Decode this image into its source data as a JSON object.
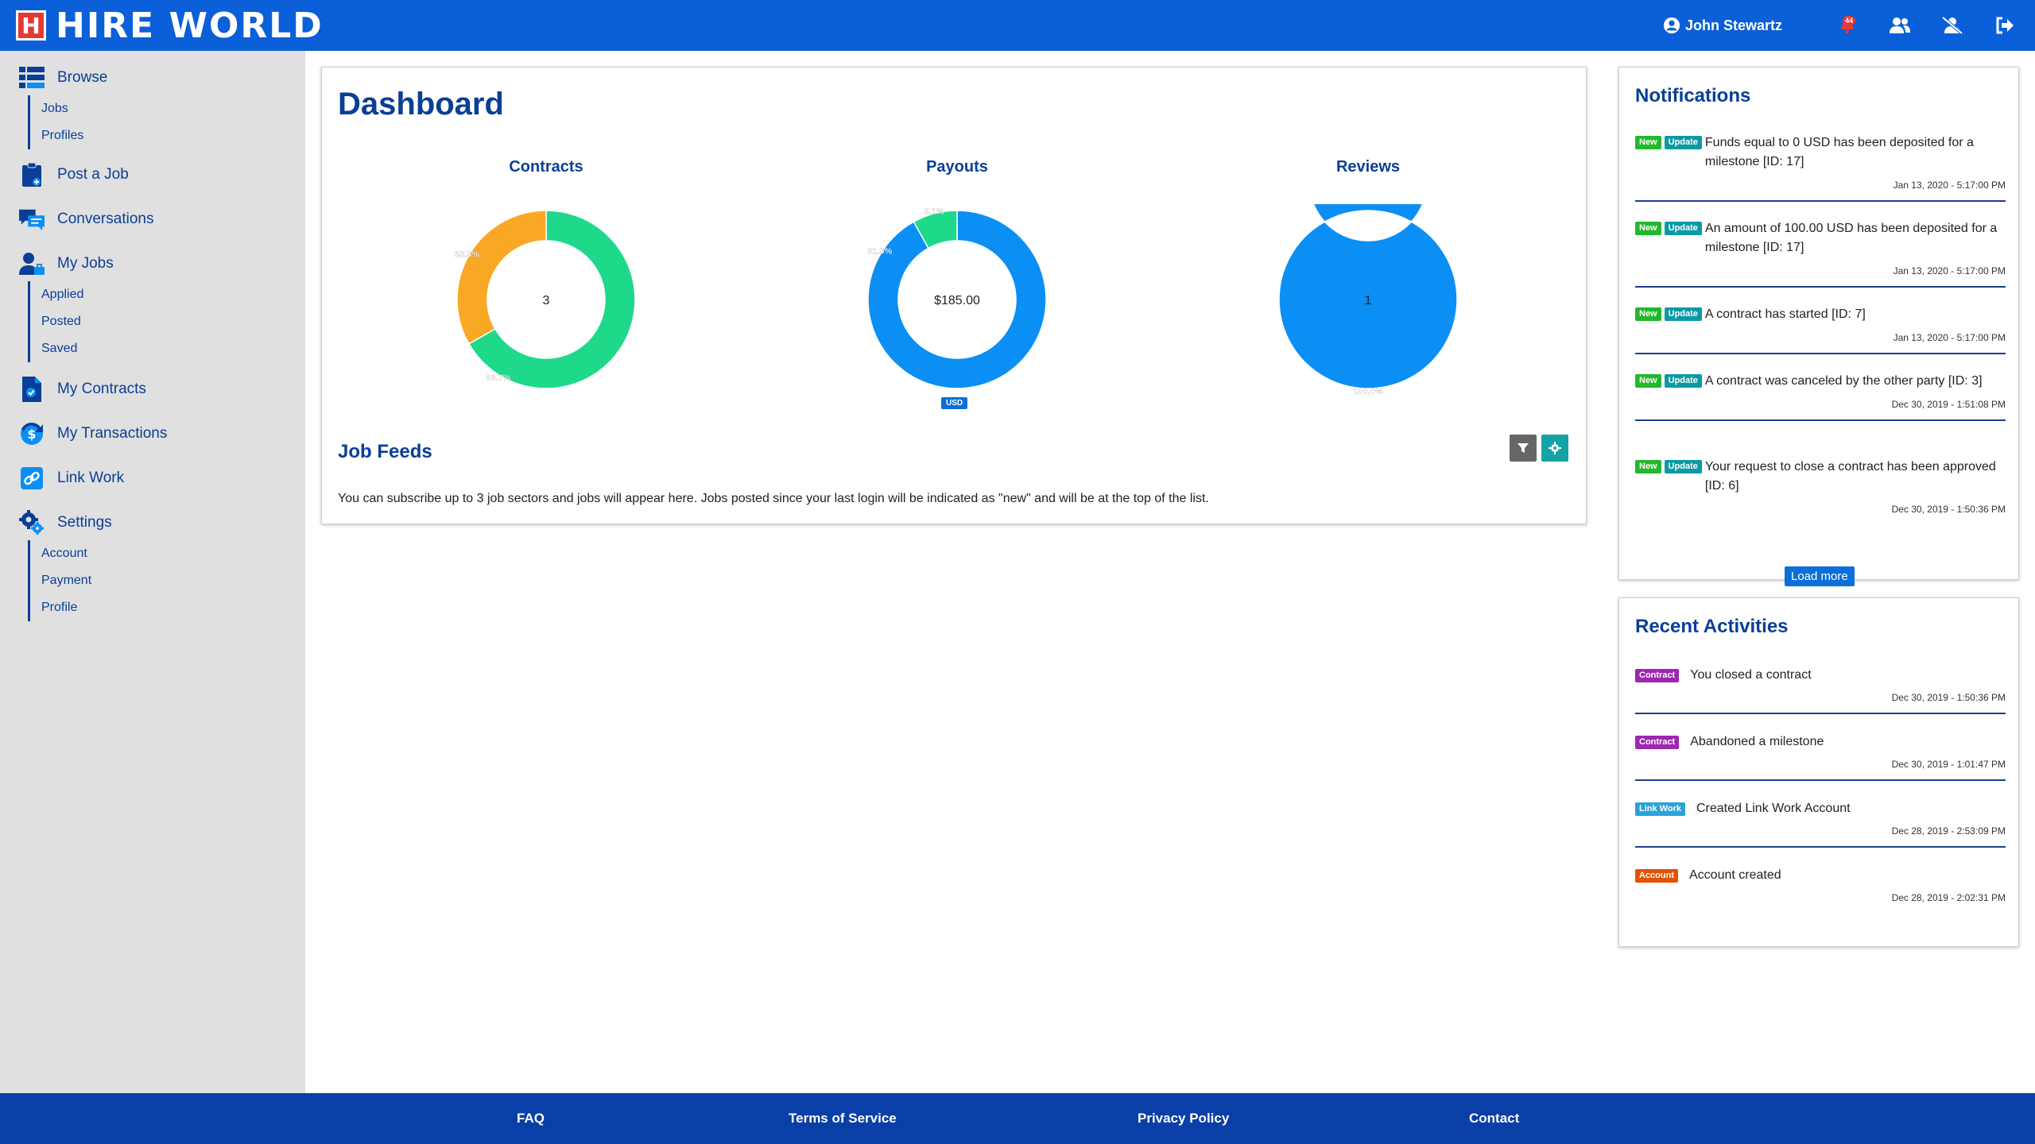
{
  "app": {
    "logo_mark": "H",
    "logo_text": "HIRE WORLD"
  },
  "topnav": {
    "user_name": "John Stewartz",
    "alert_badge": "44",
    "icons": [
      "user-circle-icon",
      "alert-icon",
      "users-icon",
      "user-slash-icon",
      "logout-icon"
    ]
  },
  "sidebar": {
    "browse": {
      "label": "Browse",
      "items": [
        "Jobs",
        "Profiles"
      ]
    },
    "post_job": {
      "label": "Post a Job"
    },
    "conversations": {
      "label": "Conversations"
    },
    "my_jobs": {
      "label": "My Jobs",
      "items": [
        "Applied",
        "Posted",
        "Saved"
      ]
    },
    "my_contracts": {
      "label": "My Contracts"
    },
    "my_transactions": {
      "label": "My Transactions"
    },
    "link_work": {
      "label": "Link Work"
    },
    "settings": {
      "label": "Settings",
      "items": [
        "Account",
        "Payment",
        "Profile"
      ]
    }
  },
  "dashboard": {
    "title": "Dashboard",
    "job_feeds": {
      "title": "Job Feeds",
      "description": "You can subscribe up to 3 job sectors and jobs will appear here. Jobs posted since your last login will be indicated as \"new\" and will be at the top of the list."
    }
  },
  "chart_data": [
    {
      "type": "pie",
      "title": "Contracts",
      "center_label": "3",
      "slices": [
        {
          "value": 66.7,
          "label": "66.7%",
          "color": "#1ed98a"
        },
        {
          "value": 33.3,
          "label": "33.3%",
          "color": "#f9a825"
        }
      ]
    },
    {
      "type": "pie",
      "title": "Payouts",
      "center_label": "$185.00",
      "currency_tag": "USD",
      "slices": [
        {
          "value": 91.9,
          "label": "91.9%",
          "color": "#0b8ff5"
        },
        {
          "value": 8.1,
          "label": "8.1%",
          "color": "#1ed98a"
        }
      ]
    },
    {
      "type": "pie",
      "title": "Reviews",
      "center_label": "1",
      "slices": [
        {
          "value": 100.0,
          "label": "100.0%",
          "color": "#0b8ff5"
        }
      ]
    }
  ],
  "notifications": {
    "title": "Notifications",
    "tag_new": "New",
    "tag_update": "Update",
    "items": [
      {
        "message": "Funds equal to 0 USD has been deposited for a milestone [ID: 17]",
        "date": "Jan 13, 2020 - 5:17:00 PM"
      },
      {
        "message": "An amount of 100.00 USD has been deposited for a milestone [ID: 17]",
        "date": "Jan 13, 2020 - 5:17:00 PM"
      },
      {
        "message": "A contract has started [ID: 7]",
        "date": "Jan 13, 2020 - 5:17:00 PM"
      },
      {
        "message": "A contract was canceled by the other party [ID: 3]",
        "date": "Dec 30, 2019 - 1:51:08 PM"
      },
      {
        "message": "Your request to close a contract has been approved [ID: 6]",
        "date": "Dec 30, 2019 - 1:50:36 PM"
      }
    ],
    "load_more": "Load more"
  },
  "activities": {
    "title": "Recent Activities",
    "items": [
      {
        "tag": "Contract",
        "message": "You closed a contract",
        "date": "Dec 30, 2019 - 1:50:36 PM"
      },
      {
        "tag": "Contract",
        "message": "Abandoned a milestone",
        "date": "Dec 30, 2019 - 1:01:47 PM"
      },
      {
        "tag": "Link Work",
        "message": "Created Link Work Account",
        "date": "Dec 28, 2019 - 2:53:09 PM"
      },
      {
        "tag": "Account",
        "message": "Account created",
        "date": "Dec 28, 2019 - 2:02:31 PM"
      }
    ]
  },
  "footer": {
    "links": [
      "FAQ",
      "Terms of Service",
      "Privacy Policy",
      "Contact"
    ]
  }
}
